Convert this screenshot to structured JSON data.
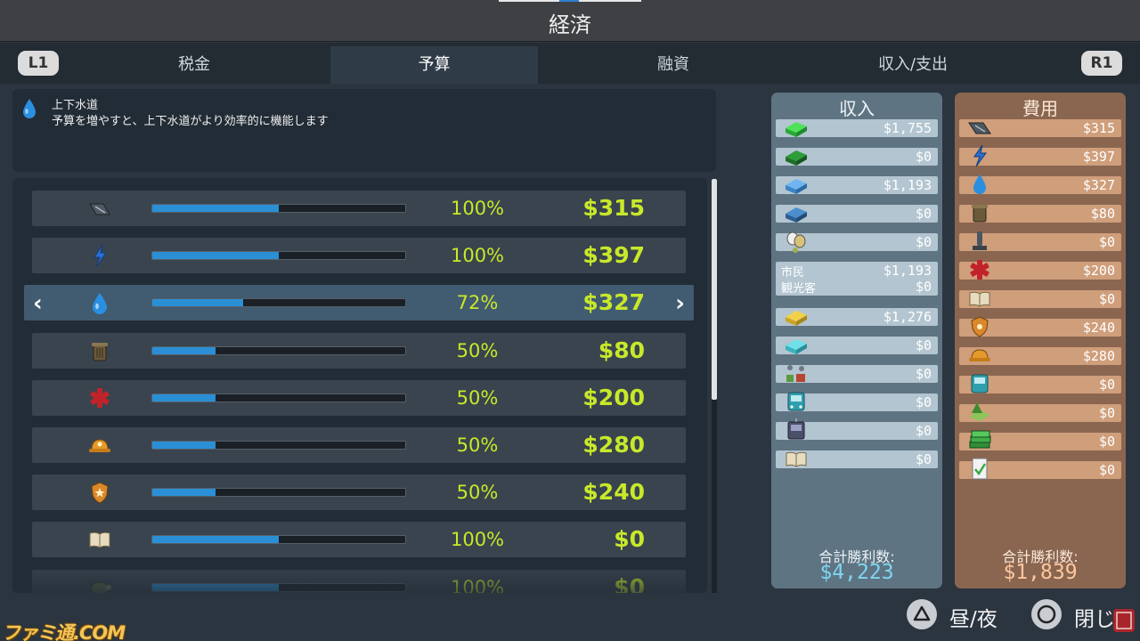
{
  "title": "経済",
  "tabs": {
    "l1": "L1",
    "r1": "R1",
    "items": [
      {
        "label": "税金"
      },
      {
        "label": "予算"
      },
      {
        "label": "融資"
      },
      {
        "label": "収入/支出"
      }
    ],
    "active": "予算"
  },
  "description": {
    "icon": "water-drop-icon",
    "title": "上下水道",
    "text": "予算を増やすと、上下水道がより効率的に機能します"
  },
  "budget_rows": [
    {
      "icon": "road-icon",
      "percent": 1.0,
      "percent_label": "100%",
      "amount": "$315"
    },
    {
      "icon": "electricity-icon",
      "percent": 1.0,
      "percent_label": "100%",
      "amount": "$397"
    },
    {
      "icon": "water-drop-icon",
      "percent": 0.72,
      "percent_label": "72%",
      "amount": "$327",
      "selected": true
    },
    {
      "icon": "garbage-bin-icon",
      "percent": 0.5,
      "percent_label": "50%",
      "amount": "$80"
    },
    {
      "icon": "health-cross-icon",
      "percent": 0.5,
      "percent_label": "50%",
      "amount": "$200"
    },
    {
      "icon": "fire-helmet-icon",
      "percent": 0.5,
      "percent_label": "50%",
      "amount": "$280"
    },
    {
      "icon": "police-badge-icon",
      "percent": 0.5,
      "percent_label": "50%",
      "amount": "$240"
    },
    {
      "icon": "education-book-icon",
      "percent": 1.0,
      "percent_label": "100%",
      "amount": "$0"
    },
    {
      "icon": "turtle-icon",
      "percent": 1.0,
      "percent_label": "100%",
      "amount": "$0"
    }
  ],
  "income": {
    "title": "収入",
    "rows": [
      {
        "icon": "residential-green-icon",
        "value": "$1,755"
      },
      {
        "icon": "residential-dark-green-icon",
        "value": "$0"
      },
      {
        "icon": "commercial-blue-icon",
        "value": "$1,193"
      },
      {
        "icon": "commercial-dark-blue-icon",
        "value": "$0"
      },
      {
        "icon": "tourism-masks-icon",
        "value": "$0"
      },
      {
        "label1": "市民",
        "value1": "$1,193",
        "label2": "観光客",
        "value2": "$0"
      },
      {
        "icon": "industrial-yellow-icon",
        "value": "$1,276"
      },
      {
        "icon": "office-cyan-icon",
        "value": "$0"
      },
      {
        "icon": "farming-icon",
        "value": "$0"
      },
      {
        "icon": "bus-icon",
        "value": "$0"
      },
      {
        "icon": "tram-icon",
        "value": "$0"
      },
      {
        "icon": "book-icon",
        "value": "$0"
      }
    ],
    "total_label": "合計勝利数:",
    "total": "$4,223"
  },
  "expenses": {
    "title": "費用",
    "rows": [
      {
        "icon": "road-icon",
        "value": "$315"
      },
      {
        "icon": "electricity-icon",
        "value": "$397"
      },
      {
        "icon": "water-drop-icon",
        "value": "$327"
      },
      {
        "icon": "garbage-bin-icon",
        "value": "$80"
      },
      {
        "icon": "monument-icon",
        "value": "$0"
      },
      {
        "icon": "health-cross-icon",
        "value": "$200"
      },
      {
        "icon": "education-book-icon",
        "value": "$0"
      },
      {
        "icon": "police-badge-icon",
        "value": "$240"
      },
      {
        "icon": "fire-helmet-icon",
        "value": "$280"
      },
      {
        "icon": "bus-icon",
        "value": "$0"
      },
      {
        "icon": "park-icon",
        "value": "$0"
      },
      {
        "icon": "money-stack-icon",
        "value": "$0"
      },
      {
        "icon": "policy-check-icon",
        "value": "$0"
      }
    ],
    "total_label": "合計勝利数:",
    "total": "$1,839"
  },
  "footer": {
    "triangle_label": "昼/夜",
    "circle_label": "閉じる"
  },
  "watermark": "ファミ通.COM",
  "colors": {
    "accent_blue": "#2b8fd6",
    "value_yellow_green": "#c8e82a",
    "income_panel": "#5f7483",
    "expense_panel": "#8a6650"
  }
}
